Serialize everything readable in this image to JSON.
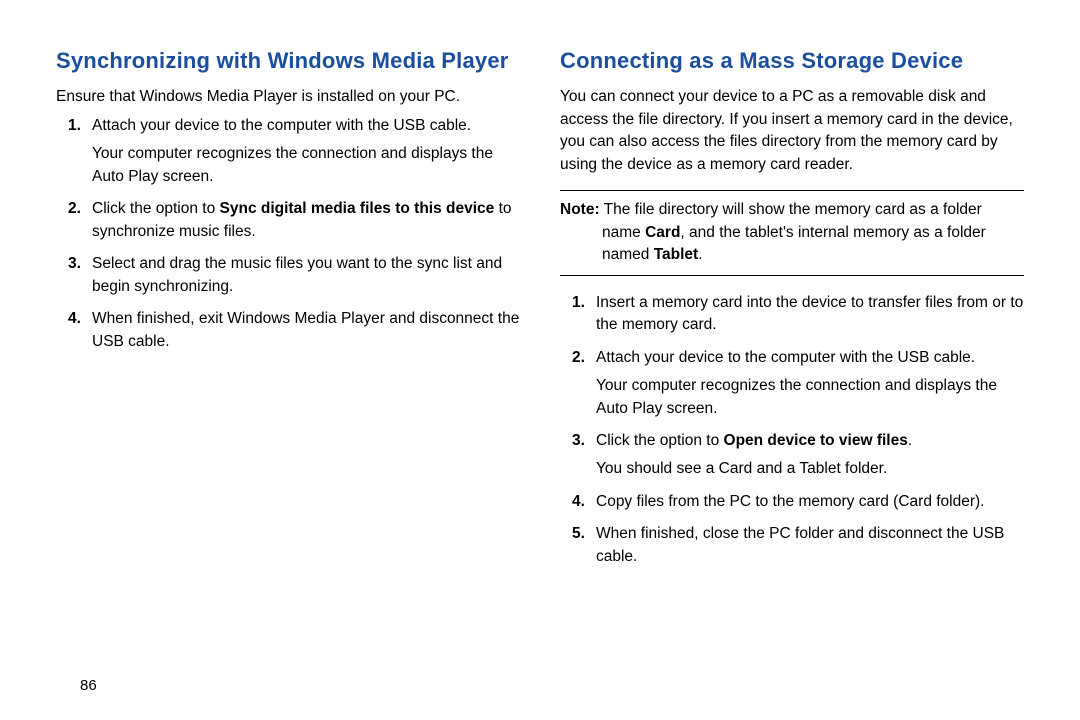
{
  "left": {
    "heading": "Synchronizing with Windows Media Player",
    "intro": "Ensure that Windows Media Player is installed on your PC.",
    "steps": [
      {
        "text": "Attach your device to the computer with the USB cable.",
        "extra": "Your computer recognizes the connection and displays the Auto Play screen."
      },
      {
        "pre": "Click the option to ",
        "bold": "Sync digital media files to this device",
        "post": " to synchronize music files."
      },
      {
        "text": "Select and drag the music files you want to the sync list and begin synchronizing."
      },
      {
        "text": "When finished, exit Windows Media Player and disconnect the USB cable."
      }
    ]
  },
  "right": {
    "heading": "Connecting as a Mass Storage Device",
    "intro": "You can connect your device to a PC as a removable disk and access the file directory. If you insert a memory card in the device, you can also access the files directory from the memory card by using the device as a memory card reader.",
    "note": {
      "label": "Note:",
      "pre": " The file directory will show the memory card as a folder name ",
      "bold1": "Card",
      "mid": ", and the tablet's internal memory as a folder named ",
      "bold2": "Tablet",
      "post": "."
    },
    "steps": [
      {
        "text": "Insert a memory card into the device to transfer files from or to the memory card."
      },
      {
        "text": "Attach your device to the computer with the USB cable.",
        "extra": "Your computer recognizes the connection and displays the Auto Play screen."
      },
      {
        "pre": "Click the option to ",
        "bold": "Open device to view files",
        "post": ".",
        "extra": "You should see a Card and a Tablet folder."
      },
      {
        "text": "Copy files from the PC to the memory card (Card folder)."
      },
      {
        "text": "When finished, close the PC folder and disconnect the USB cable."
      }
    ]
  },
  "pageNumber": "86"
}
